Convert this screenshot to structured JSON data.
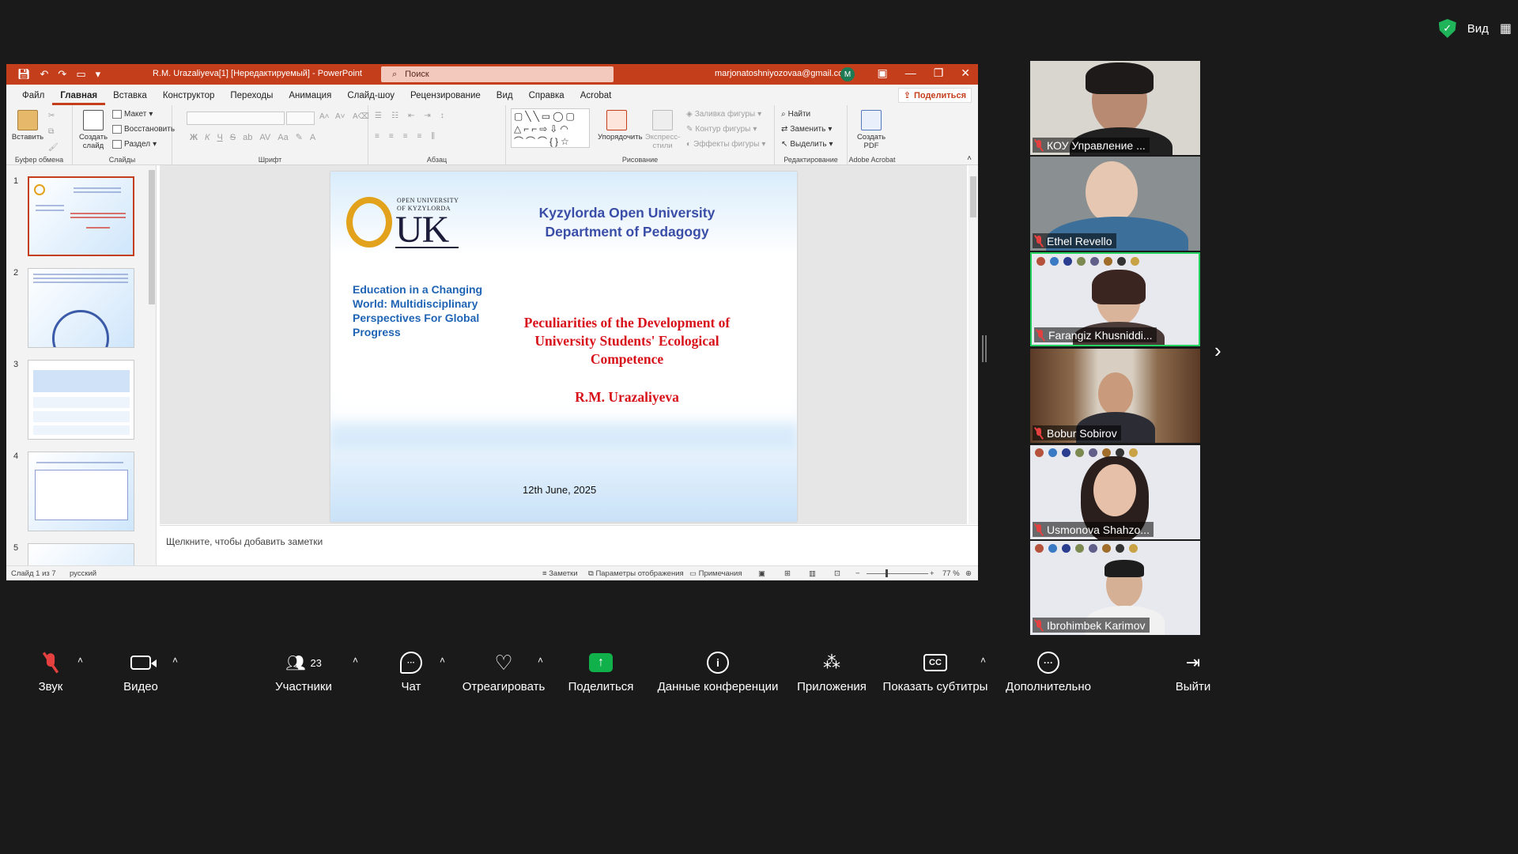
{
  "zoom_top": {
    "view_label": "Вид"
  },
  "ppt": {
    "title": "R.M. Urazaliyeva[1] [Нередактируемый]  -  PowerPoint",
    "search_placeholder": "Поиск",
    "account_email": "marjonatoshniyozovaa@gmail.com",
    "account_initial": "M",
    "tabs": [
      "Файл",
      "Главная",
      "Вставка",
      "Конструктор",
      "Переходы",
      "Анимация",
      "Слайд-шоу",
      "Рецензирование",
      "Вид",
      "Справка",
      "Acrobat"
    ],
    "share_label": "Поделиться",
    "ribbon": {
      "clipboard": {
        "paste": "Вставить",
        "label": "Буфер обмена"
      },
      "slides": {
        "new_slide": "Создать слайд",
        "layout": "Макет",
        "reset": "Восстановить",
        "section": "Раздел",
        "label": "Слайды"
      },
      "font_label": "Шрифт",
      "paragraph_label": "Абзац",
      "drawing": {
        "arrange": "Упорядочить",
        "quick_styles": "Экспресс-стили",
        "fill": "Заливка фигуры",
        "outline": "Контур фигуры",
        "effects": "Эффекты фигуры",
        "label": "Рисование"
      },
      "editing": {
        "find": "Найти",
        "replace": "Заменить",
        "select": "Выделить",
        "label": "Редактирование"
      },
      "acrobat": {
        "create_pdf": "Создать PDF",
        "label": "Adobe Acrobat"
      }
    },
    "thumb_numbers": [
      "1",
      "2",
      "3",
      "4",
      "5"
    ],
    "slide": {
      "logo_small": "OPEN UNIVERSITY\nOF KYZYLORDA",
      "logo_uk": "UK",
      "university": "Kyzylorda Open University\nDepartment of Pedagogy",
      "conference": "Education in a Changing World: Multidisciplinary Perspectives For Global Progress",
      "title": "Peculiarities of the Development of University Students' Ecological Competence",
      "author": "R.M. Urazaliyeva",
      "date": "12th June, 2025"
    },
    "notes_placeholder": "Щелкните, чтобы добавить заметки",
    "status": {
      "slide_info": "Слайд 1 из 7",
      "language": "русский",
      "notes": "Заметки",
      "display_settings": "Параметры отображения",
      "comments": "Примечания",
      "zoom": "77 %"
    }
  },
  "participants": [
    {
      "name": "КОУ Управление ..."
    },
    {
      "name": "Ethel Revello"
    },
    {
      "name": "Farangiz Khusniddi..."
    },
    {
      "name": "Bobur Sobirov"
    },
    {
      "name": "Usmonova Shahzo..."
    },
    {
      "name": "Ibrohimbek Karimov"
    }
  ],
  "toolbar": {
    "audio": "Звук",
    "video": "Видео",
    "participants": "Участники",
    "participants_count": "23",
    "chat": "Чат",
    "react": "Отреагировать",
    "share": "Поделиться",
    "meeting_info": "Данные конференции",
    "apps": "Приложения",
    "captions": "Показать субтитры",
    "captions_icon": "CC",
    "more": "Дополнительно",
    "leave": "Выйти"
  },
  "colors": {
    "ppt_accent": "#c43e1c",
    "zoom_share": "#10b04a",
    "active_speaker": "#23d160",
    "slide_title": "#d8121a"
  }
}
